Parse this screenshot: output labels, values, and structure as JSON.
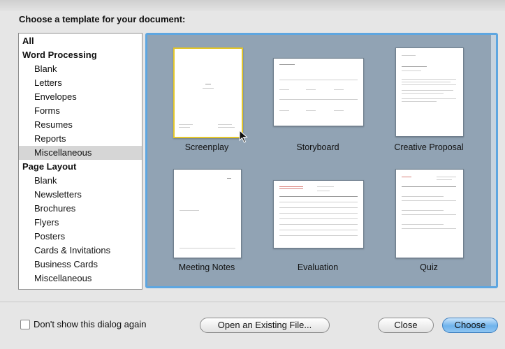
{
  "dialog": {
    "heading": "Choose a template for your document:"
  },
  "sidebar": {
    "all": "All",
    "word_processing": {
      "label": "Word Processing",
      "items": [
        "Blank",
        "Letters",
        "Envelopes",
        "Forms",
        "Resumes",
        "Reports",
        "Miscellaneous"
      ]
    },
    "page_layout": {
      "label": "Page Layout",
      "items": [
        "Blank",
        "Newsletters",
        "Brochures",
        "Flyers",
        "Posters",
        "Cards & Invitations",
        "Business Cards",
        "Miscellaneous"
      ]
    },
    "selected": "Word Processing / Miscellaneous"
  },
  "templates": [
    {
      "name": "Screenplay",
      "selected": true
    },
    {
      "name": "Storyboard",
      "selected": false
    },
    {
      "name": "Creative Proposal",
      "selected": false
    },
    {
      "name": "Meeting Notes",
      "selected": false
    },
    {
      "name": "Evaluation",
      "selected": false
    },
    {
      "name": "Quiz",
      "selected": false
    }
  ],
  "footer": {
    "checkbox_label": "Don't show this dialog again",
    "checkbox_checked": false,
    "open_existing_label": "Open an Existing File...",
    "close_label": "Close",
    "choose_label": "Choose"
  },
  "colors": {
    "gallery_background": "#91a3b4",
    "focus_ring": "#5ea6e0",
    "selection_border": "#e3c62b",
    "primary_button": "#6fb3ec"
  }
}
